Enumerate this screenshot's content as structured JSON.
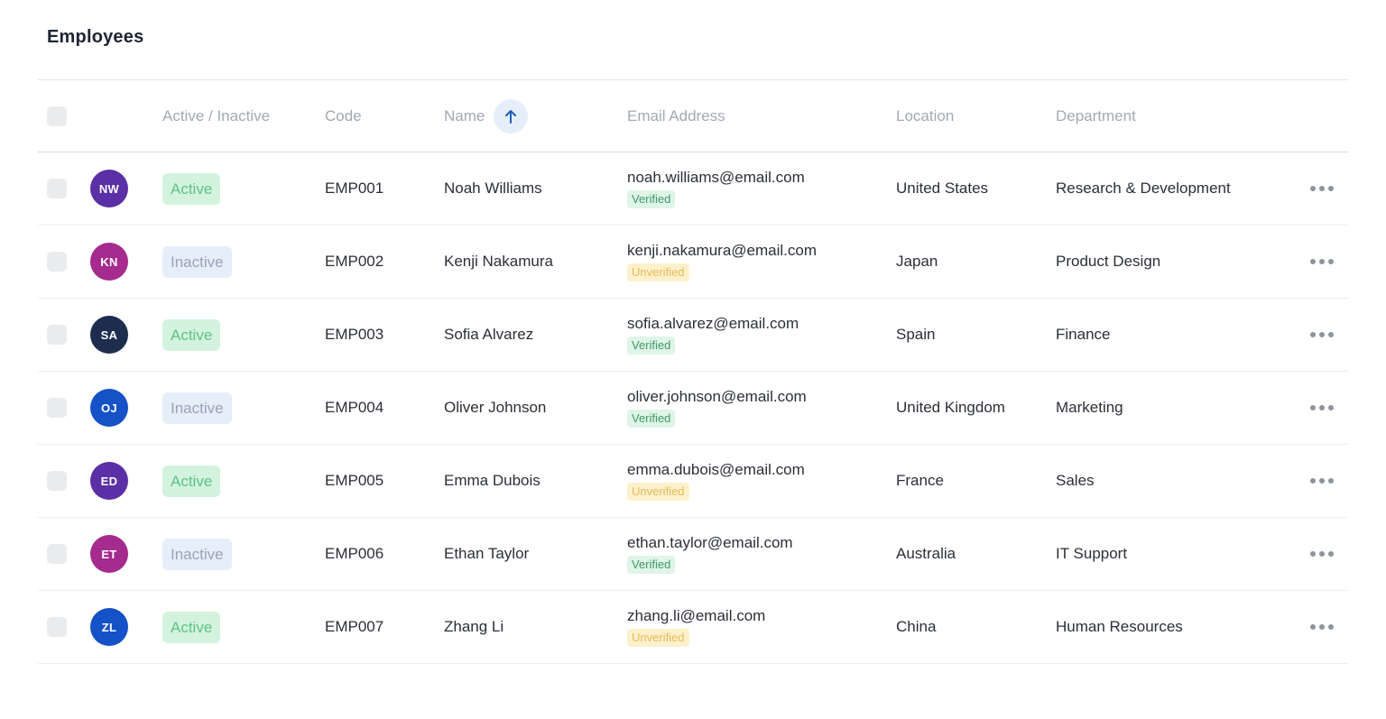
{
  "page": {
    "title": "Employees"
  },
  "table": {
    "headers": {
      "status": "Active / Inactive",
      "code": "Code",
      "name": "Name",
      "email": "Email Address",
      "location": "Location",
      "department": "Department"
    },
    "sort": {
      "column": "name",
      "direction": "ascending",
      "icon": "arrow-up-icon",
      "color": "#1c5fbf"
    },
    "rows": [
      {
        "initials": "NW",
        "avatar_color": "#5b2fa6",
        "status": "Active",
        "code": "EMP001",
        "name": "Noah Williams",
        "email": "noah.williams@email.com",
        "email_status": "Verified",
        "location": "United States",
        "department": "Research & Development"
      },
      {
        "initials": "KN",
        "avatar_color": "#a52b8f",
        "status": "Inactive",
        "code": "EMP002",
        "name": "Kenji Nakamura",
        "email": "kenji.nakamura@email.com",
        "email_status": "Unverified",
        "location": "Japan",
        "department": "Product Design"
      },
      {
        "initials": "SA",
        "avatar_color": "#1d2d4e",
        "status": "Active",
        "code": "EMP003",
        "name": "Sofia Alvarez",
        "email": "sofia.alvarez@email.com",
        "email_status": "Verified",
        "location": "Spain",
        "department": "Finance"
      },
      {
        "initials": "OJ",
        "avatar_color": "#1551c7",
        "status": "Inactive",
        "code": "EMP004",
        "name": "Oliver Johnson",
        "email": "oliver.johnson@email.com",
        "email_status": "Verified",
        "location": "United Kingdom",
        "department": "Marketing"
      },
      {
        "initials": "ED",
        "avatar_color": "#5b2fa6",
        "status": "Active",
        "code": "EMP005",
        "name": "Emma Dubois",
        "email": "emma.dubois@email.com",
        "email_status": "Unverified",
        "location": "France",
        "department": "Sales"
      },
      {
        "initials": "ET",
        "avatar_color": "#a52b8f",
        "status": "Inactive",
        "code": "EMP006",
        "name": "Ethan Taylor",
        "email": "ethan.taylor@email.com",
        "email_status": "Verified",
        "location": "Australia",
        "department": "IT Support"
      },
      {
        "initials": "ZL",
        "avatar_color": "#1551c7",
        "status": "Active",
        "code": "EMP007",
        "name": "Zhang Li",
        "email": "zhang.li@email.com",
        "email_status": "Unverified",
        "location": "China",
        "department": "Human Resources"
      }
    ]
  },
  "colors": {
    "active_bg": "#d3f3de",
    "active_text": "#5ec286",
    "inactive_bg": "#e6eefa",
    "inactive_text": "#98a4b8",
    "verified_bg": "#dff5e7",
    "verified_text": "#3f9968",
    "unverified_bg": "#fdf1cd",
    "unverified_text": "#e6bb57"
  },
  "icons": {
    "row_menu": "more-horizontal-icon"
  }
}
